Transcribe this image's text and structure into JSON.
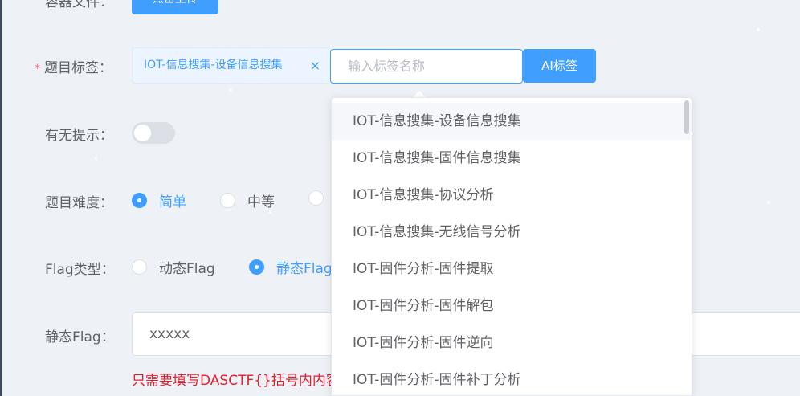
{
  "form": {
    "attachment": {
      "label": "容器文件：",
      "button": "点击上传"
    },
    "tags": {
      "label": "题目标签：",
      "selected": "IOT-信息搜集-设备信息搜集",
      "remove_glyph": "×",
      "input_placeholder": "输入标签名称",
      "ai_button": "AI标签"
    },
    "hint_toggle": {
      "label": "有无提示：",
      "on": false
    },
    "difficulty": {
      "label": "题目难度：",
      "options": [
        "简单",
        "中等",
        ""
      ],
      "selected": "简单"
    },
    "flag_type": {
      "label": "Flag类型：",
      "options": [
        "动态Flag",
        "静态Flag"
      ],
      "selected": "静态Flag"
    },
    "static_flag": {
      "label": "静态Flag：",
      "value": "xxxxx",
      "hint": "只需要填写DASCTF{}括号内内容"
    }
  },
  "dropdown": {
    "items": [
      "IOT-信息搜集-设备信息搜集",
      "IOT-信息搜集-固件信息搜集",
      "IOT-信息搜集-协议分析",
      "IOT-信息搜集-无线信号分析",
      "IOT-固件分析-固件提取",
      "IOT-固件分析-固件解包",
      "IOT-固件分析-固件逆向",
      "IOT-固件分析-固件补丁分析"
    ],
    "highlighted_index": 0
  },
  "colors": {
    "primary": "#409eff",
    "required": "#f56c6c",
    "hint": "#e5202e"
  }
}
